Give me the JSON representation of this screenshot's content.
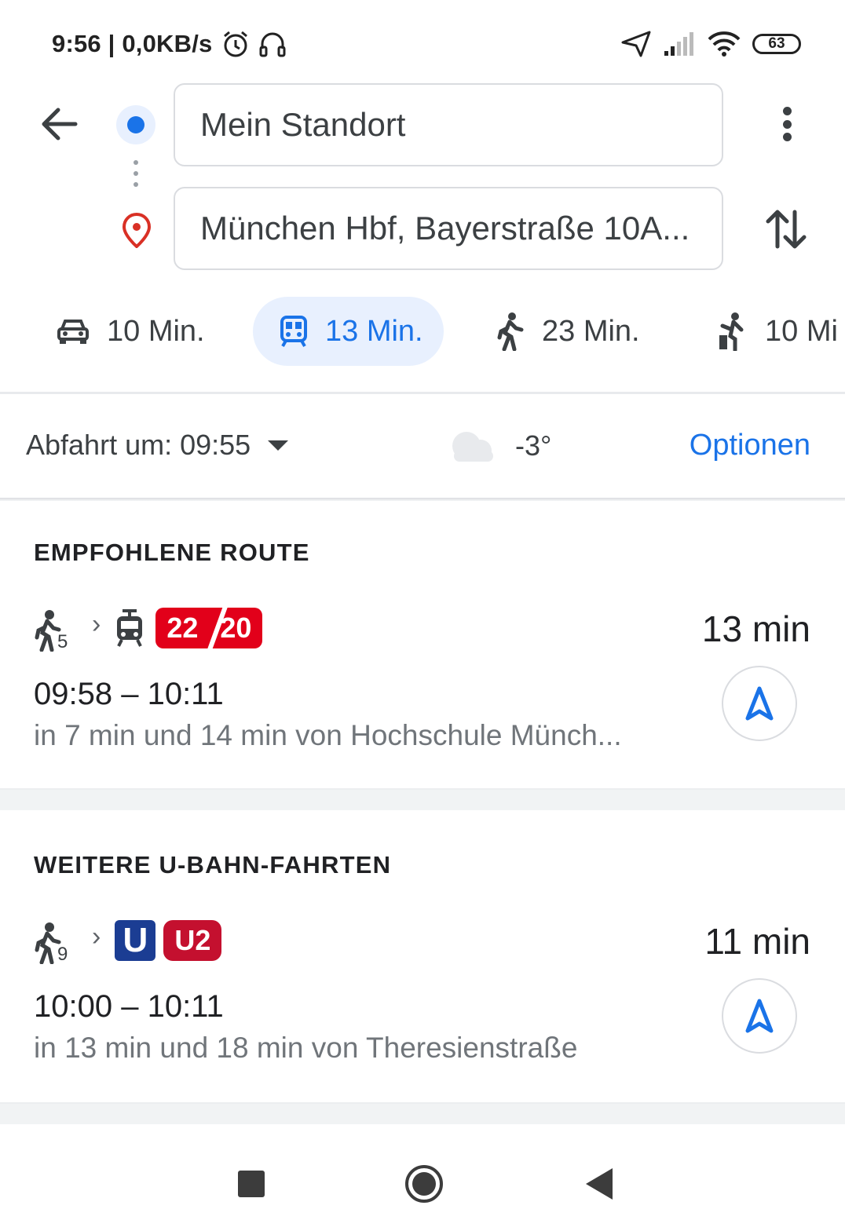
{
  "status_bar": {
    "time_speed": "9:56 | 0,0KB/s",
    "battery": "63"
  },
  "search": {
    "origin": "Mein Standort",
    "destination": "München Hbf, Bayerstraße 10A..."
  },
  "modes": [
    {
      "icon": "car-icon",
      "label": "10 Min.",
      "active": false
    },
    {
      "icon": "transit-icon",
      "label": "13 Min.",
      "active": true
    },
    {
      "icon": "walk-icon",
      "label": "23 Min.",
      "active": false
    },
    {
      "icon": "rideshare-icon",
      "label": "10 Mi",
      "active": false
    }
  ],
  "filter_row": {
    "departure": "Abfahrt um: 09:55",
    "weather": "-3°",
    "options": "Optionen"
  },
  "recommended": {
    "section_title": "EMPFOHLENE ROUTE",
    "walk_minutes": "5",
    "line_a": "22",
    "line_b": "20",
    "duration": "13 min",
    "times": "09:58 – 10:11",
    "subtitle": "in 7 min und 14 min von Hochschule Münch..."
  },
  "more_ubahn": {
    "section_title": "WEITERE U-BAHN-FAHRTEN",
    "walk_minutes": "9",
    "logo": "U",
    "line": "U2",
    "duration": "11 min",
    "times": "10:00 – 10:11",
    "subtitle": "in 13 min und 18 min von Theresienstraße"
  },
  "colors": {
    "accent": "#1a73e8",
    "tram_red": "#e2001a",
    "ubahn_blue": "#1b3d93",
    "u2_red": "#c4102f"
  }
}
